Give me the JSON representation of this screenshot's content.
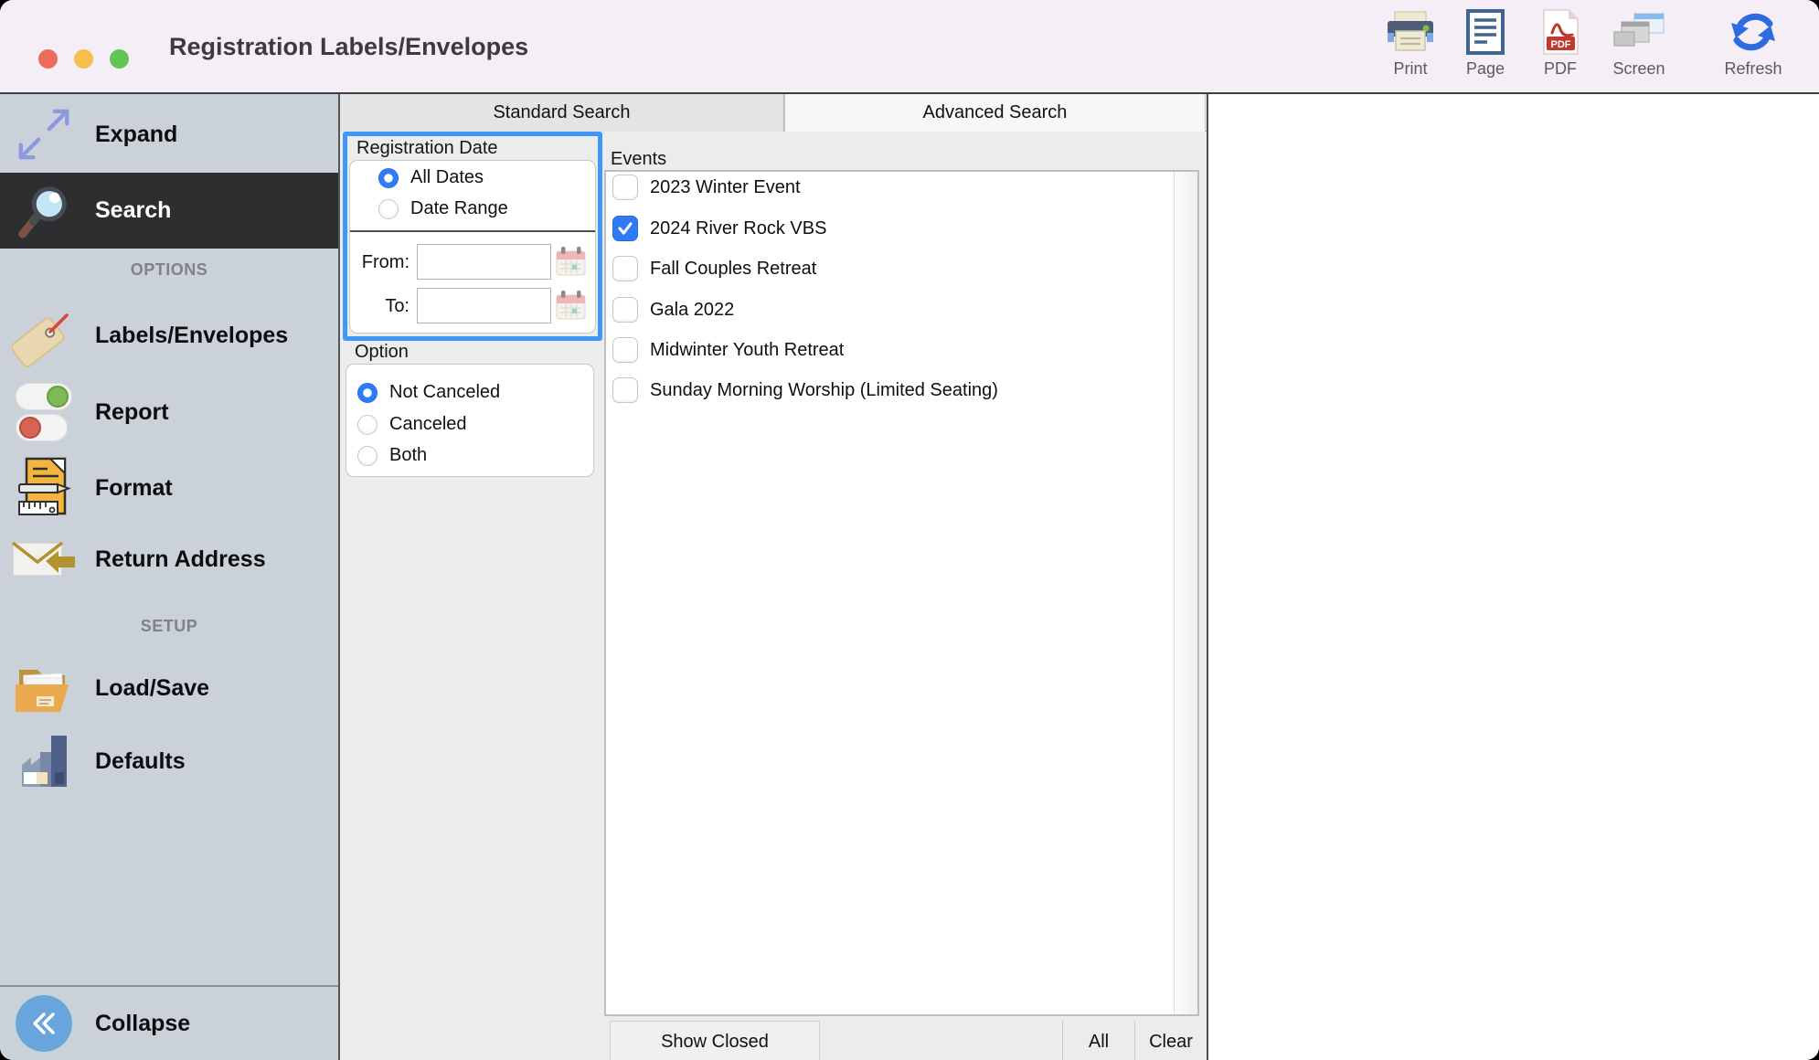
{
  "window": {
    "title": "Registration Labels/Envelopes"
  },
  "toolbar": {
    "items": [
      {
        "label": "Print"
      },
      {
        "label": "Page"
      },
      {
        "label": "PDF"
      },
      {
        "label": "Screen"
      },
      {
        "label": "Refresh"
      }
    ],
    "pdf_badge": "PDF"
  },
  "sidebar": {
    "expand": "Expand",
    "search": "Search",
    "options_header": "OPTIONS",
    "labels_envelopes": "Labels/Envelopes",
    "report": "Report",
    "format": "Format",
    "return_address": "Return Address",
    "setup_header": "SETUP",
    "load_save": "Load/Save",
    "defaults": "Defaults",
    "collapse": "Collapse",
    "selected_item": "Search"
  },
  "tabs": {
    "standard": "Standard Search",
    "advanced": "Advanced Search",
    "active": "Advanced Search"
  },
  "registration_date": {
    "title": "Registration Date",
    "radios": [
      {
        "label": "All Dates",
        "selected": true
      },
      {
        "label": "Date Range",
        "selected": false
      }
    ],
    "from_label": "From:",
    "from_value": "",
    "to_label": "To:",
    "to_value": ""
  },
  "option_panel": {
    "title": "Option",
    "radios": [
      {
        "label": "Not Canceled",
        "selected": true
      },
      {
        "label": "Canceled",
        "selected": false
      },
      {
        "label": "Both",
        "selected": false
      }
    ]
  },
  "events": {
    "title": "Events",
    "items": [
      {
        "label": "2023 Winter Event",
        "checked": false
      },
      {
        "label": "2024 River Rock VBS",
        "checked": true
      },
      {
        "label": "Fall Couples Retreat",
        "checked": false
      },
      {
        "label": "Gala 2022",
        "checked": false
      },
      {
        "label": "Midwinter Youth Retreat",
        "checked": false
      },
      {
        "label": "Sunday Morning Worship (Limited Seating)",
        "checked": false
      }
    ],
    "footer": {
      "show_closed": "Show Closed",
      "all": "All",
      "clear": "Clear"
    }
  },
  "colors": {
    "titlebar_bg": "#f6eef6",
    "sidebar_bg": "#cbd1d9",
    "sidebar_selected_bg": "#2d2e30",
    "focus_ring": "#3f97f6",
    "accent_blue": "#2f7bf5",
    "traffic_red": "#ed6a5e",
    "traffic_yellow": "#f4bf4f",
    "traffic_green": "#61c454",
    "toggle_green": "#7db955",
    "toggle_red": "#d96352"
  }
}
